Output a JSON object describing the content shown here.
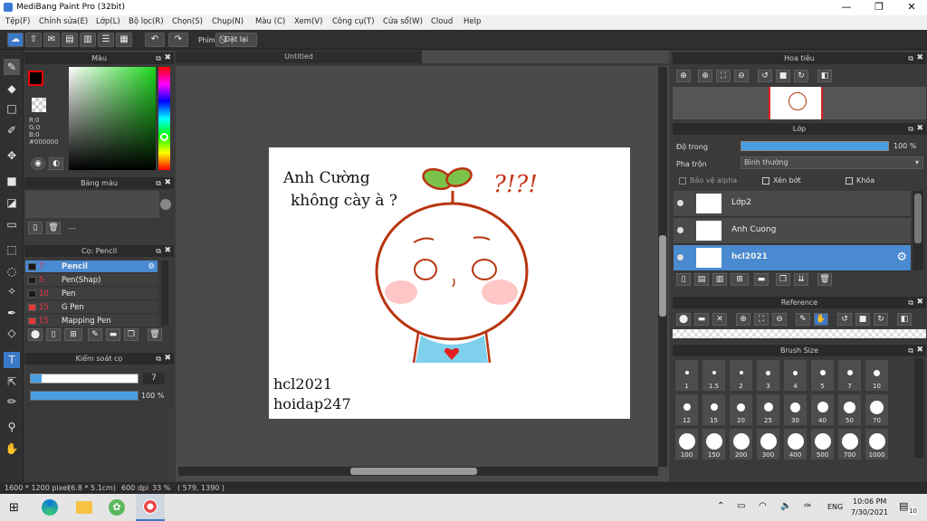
{
  "window": {
    "title": "MediBang Paint Pro (32bit)",
    "minimize": "—",
    "maximize": "❐",
    "close": "✕"
  },
  "menu": [
    "Tệp(F)",
    "Chỉnh sửa(E)",
    "Lớp(L)",
    "Bộ lọc(R)",
    "Chọn(S)",
    "Chụp(N)",
    "Màu (C)",
    "Xem(V)",
    "Công cụ(T)",
    "Cửa sổ(W)",
    "Cloud",
    "Help"
  ],
  "toolbar": {
    "key_label": "Phím",
    "reset_label": "Đặt lại"
  },
  "panels": {
    "color": {
      "title": "Màu",
      "r": "R:0",
      "g": "G:0",
      "b": "B:0",
      "hex": "#000000"
    },
    "palette": {
      "title": "Bảng màu",
      "dash": "---"
    },
    "brush": {
      "title": "Cọ: Pencil",
      "items": [
        {
          "size": "7",
          "name": "Pencil",
          "selected": true,
          "swatch": "#1a1a1a"
        },
        {
          "size": "5",
          "name": "Pen(Shap)",
          "selected": false,
          "swatch": "#1a1a1a"
        },
        {
          "size": "10",
          "name": "Pen",
          "selected": false,
          "swatch": "#1a1a1a"
        },
        {
          "size": "15",
          "name": "G Pen",
          "selected": false,
          "swatch": "#e53935"
        },
        {
          "size": "15",
          "name": "Mapping Pen",
          "selected": false,
          "swatch": "#e53935"
        }
      ]
    },
    "brush_control": {
      "title": "Kiểm soát cọ",
      "size_value": "7",
      "opacity_value": "100 %",
      "opacity_fraction": 1.0,
      "size_fraction": 0.1
    },
    "navigator": {
      "title": "Hoa tiêu"
    },
    "layer": {
      "title": "Lớp",
      "opacity_label": "Độ trong",
      "opacity_value": "100 %",
      "blend_label": "Pha trộn",
      "blend_value": "Bình thường",
      "protect_alpha": "Bảo vệ alpha",
      "clipping": "Xén bớt",
      "lock": "Khóa",
      "layers": [
        {
          "name": "Lớp2",
          "selected": false
        },
        {
          "name": "Anh Cuong",
          "selected": false
        },
        {
          "name": "hcl2021",
          "selected": true
        }
      ]
    },
    "reference": {
      "title": "Reference"
    },
    "brush_size": {
      "title": "Brush Size",
      "sizes": [
        "1",
        "1.5",
        "2",
        "3",
        "4",
        "5",
        "7",
        "10",
        "12",
        "15",
        "20",
        "25",
        "30",
        "40",
        "50",
        "70",
        "100",
        "150",
        "200",
        "300",
        "400",
        "500",
        "700",
        "1000"
      ]
    }
  },
  "document": {
    "tab": "Untitled",
    "text1": "Anh Cường",
    "text2": "không cày à ?",
    "marks": "?!?!",
    "sig1": "hcl2021",
    "sig2": "hoidap247"
  },
  "status": {
    "size": "1600 * 1200 pixel",
    "cm": "(6.8 * 5.1cm)",
    "dpi": "600 dpi",
    "zoom": "33 %",
    "coord": "( 579, 1390 )"
  },
  "taskbar": {
    "lang": "ENG",
    "time": "10:06 PM",
    "date": "7/30/2021",
    "notif": "10"
  }
}
